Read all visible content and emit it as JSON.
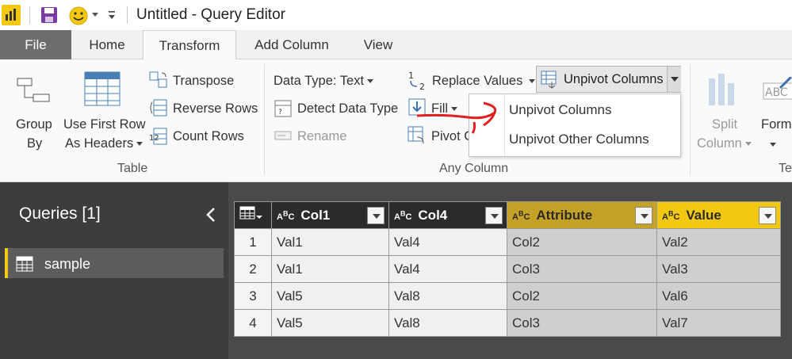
{
  "window": {
    "title": "Untitled - Query Editor"
  },
  "tabs": [
    "File",
    "Home",
    "Transform",
    "Add Column",
    "View"
  ],
  "ribbon": {
    "table_group": {
      "label": "Table",
      "group_by_line1": "Group",
      "group_by_line2": "By",
      "use_first_row_line1": "Use First Row",
      "use_first_row_line2": "As Headers",
      "transpose": "Transpose",
      "reverse_rows": "Reverse Rows",
      "count_rows": "Count Rows"
    },
    "any_column_group": {
      "label": "Any Column",
      "data_type": "Data Type: Text",
      "detect_data_type": "Detect Data Type",
      "rename": "Rename",
      "replace_values": "Replace Values",
      "fill": "Fill",
      "pivot_column": "Pivot C",
      "unpivot_columns": "Unpivot Columns"
    },
    "text_group": {
      "label": "Tex",
      "split_line1": "Split",
      "split_line2": "Column",
      "format": "Form"
    }
  },
  "unpivot_menu": {
    "items": [
      "Unpivot Columns",
      "Unpivot Other Columns"
    ]
  },
  "queries": {
    "title": "Queries [1]",
    "items": [
      "sample"
    ]
  },
  "grid": {
    "columns": [
      {
        "name": "Col1",
        "type_icon": "ABC"
      },
      {
        "name": "Col4",
        "type_icon": "ABC"
      },
      {
        "name": "Attribute",
        "type_icon": "ABC"
      },
      {
        "name": "Value",
        "type_icon": "ABC"
      }
    ],
    "rows": [
      {
        "n": "1",
        "cells": [
          "Val1",
          "Val4",
          "Col2",
          "Val2"
        ]
      },
      {
        "n": "2",
        "cells": [
          "Val1",
          "Val4",
          "Col3",
          "Val3"
        ]
      },
      {
        "n": "3",
        "cells": [
          "Val5",
          "Val8",
          "Col2",
          "Val6"
        ]
      },
      {
        "n": "4",
        "cells": [
          "Val5",
          "Val8",
          "Col3",
          "Val7"
        ]
      }
    ]
  },
  "colors": {
    "accent_yellow": "#f2c811",
    "annotation_red": "#e02020",
    "panel_dark": "#3d3d3d"
  }
}
